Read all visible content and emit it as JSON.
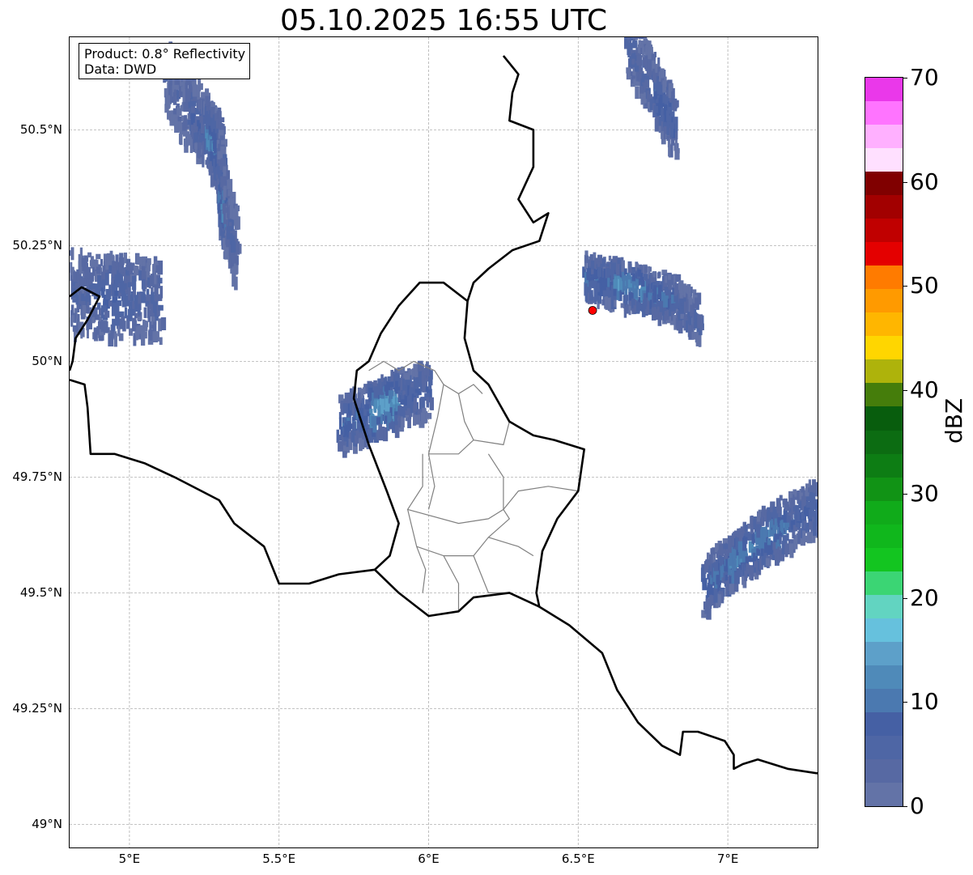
{
  "title": "05.10.2025 16:55 UTC",
  "info_box": {
    "product": "Product: 0.8° Reflectivity",
    "data": "Data: DWD"
  },
  "map": {
    "lon_range": [
      4.8,
      7.3
    ],
    "lat_range": [
      48.95,
      50.7
    ],
    "x_ticks": [
      {
        "value": 5.0,
        "label": "5°E"
      },
      {
        "value": 5.5,
        "label": "5.5°E"
      },
      {
        "value": 6.0,
        "label": "6°E"
      },
      {
        "value": 6.5,
        "label": "6.5°E"
      },
      {
        "value": 7.0,
        "label": "7°E"
      }
    ],
    "y_ticks": [
      {
        "value": 50.5,
        "label": "50.5°N"
      },
      {
        "value": 50.25,
        "label": "50.25°N"
      },
      {
        "value": 50.0,
        "label": "50°N"
      },
      {
        "value": 49.75,
        "label": "49.75°N"
      },
      {
        "value": 49.5,
        "label": "49.5°N"
      },
      {
        "value": 49.25,
        "label": "49.25°N"
      },
      {
        "value": 49.0,
        "label": "49°N"
      }
    ],
    "grid": true,
    "radar_site": {
      "lon": 6.548,
      "lat": 50.11,
      "color": "#ff0000"
    },
    "borders": [
      [
        [
          4.8,
          50.14
        ],
        [
          4.84,
          50.16
        ],
        [
          4.9,
          50.14
        ],
        [
          4.86,
          50.09
        ],
        [
          4.82,
          50.05
        ],
        [
          4.81,
          50.0
        ],
        [
          4.8,
          49.98
        ]
      ],
      [
        [
          4.8,
          49.96
        ],
        [
          4.85,
          49.95
        ],
        [
          4.86,
          49.9
        ],
        [
          4.87,
          49.8
        ],
        [
          4.95,
          49.8
        ],
        [
          5.05,
          49.78
        ],
        [
          5.15,
          49.75
        ],
        [
          5.3,
          49.7
        ],
        [
          5.35,
          49.65
        ],
        [
          5.45,
          49.6
        ],
        [
          5.5,
          49.52
        ],
        [
          5.6,
          49.52
        ],
        [
          5.7,
          49.54
        ],
        [
          5.82,
          49.55
        ],
        [
          5.9,
          49.5
        ],
        [
          6.0,
          49.45
        ],
        [
          6.1,
          49.46
        ],
        [
          6.15,
          49.49
        ],
        [
          6.27,
          49.5
        ],
        [
          6.37,
          49.47
        ]
      ],
      [
        [
          6.25,
          50.66
        ],
        [
          6.3,
          50.62
        ],
        [
          6.28,
          50.58
        ],
        [
          6.27,
          50.52
        ],
        [
          6.35,
          50.5
        ],
        [
          6.35,
          50.42
        ],
        [
          6.3,
          50.35
        ],
        [
          6.35,
          50.3
        ],
        [
          6.4,
          50.32
        ],
        [
          6.37,
          50.26
        ],
        [
          6.28,
          50.24
        ],
        [
          6.2,
          50.2
        ],
        [
          6.15,
          50.17
        ],
        [
          6.13,
          50.13
        ],
        [
          6.12,
          50.05
        ],
        [
          6.15,
          49.98
        ],
        [
          6.2,
          49.95
        ],
        [
          6.27,
          49.87
        ],
        [
          6.35,
          49.84
        ],
        [
          6.42,
          49.83
        ],
        [
          6.52,
          49.81
        ],
        [
          6.5,
          49.72
        ],
        [
          6.43,
          49.66
        ],
        [
          6.38,
          49.59
        ],
        [
          6.36,
          49.5
        ],
        [
          6.37,
          49.47
        ],
        [
          6.47,
          49.43
        ],
        [
          6.58,
          49.37
        ],
        [
          6.63,
          49.29
        ],
        [
          6.7,
          49.22
        ],
        [
          6.78,
          49.17
        ],
        [
          6.84,
          49.15
        ],
        [
          6.85,
          49.2
        ],
        [
          6.9,
          49.2
        ],
        [
          6.99,
          49.18
        ],
        [
          7.02,
          49.15
        ],
        [
          7.02,
          49.12
        ],
        [
          7.05,
          49.13
        ],
        [
          7.1,
          49.14
        ],
        [
          7.2,
          49.12
        ],
        [
          7.3,
          49.11
        ]
      ],
      [
        [
          6.13,
          50.13
        ],
        [
          6.05,
          50.17
        ],
        [
          5.97,
          50.17
        ],
        [
          5.9,
          50.12
        ],
        [
          5.84,
          50.06
        ],
        [
          5.8,
          50.0
        ],
        [
          5.76,
          49.98
        ],
        [
          5.75,
          49.92
        ],
        [
          5.8,
          49.82
        ],
        [
          5.86,
          49.72
        ],
        [
          5.9,
          49.65
        ],
        [
          5.87,
          49.58
        ],
        [
          5.82,
          49.55
        ]
      ]
    ],
    "cantons": [
      [
        [
          5.8,
          49.98
        ],
        [
          5.85,
          50.0
        ],
        [
          5.9,
          49.98
        ],
        [
          5.95,
          50.0
        ],
        [
          6.02,
          49.98
        ],
        [
          6.05,
          49.95
        ],
        [
          6.1,
          49.93
        ],
        [
          6.15,
          49.95
        ],
        [
          6.18,
          49.93
        ]
      ],
      [
        [
          6.05,
          49.95
        ],
        [
          6.03,
          49.88
        ],
        [
          6.0,
          49.8
        ],
        [
          6.1,
          49.8
        ],
        [
          6.15,
          49.83
        ],
        [
          6.25,
          49.82
        ],
        [
          6.27,
          49.87
        ]
      ],
      [
        [
          6.1,
          49.93
        ],
        [
          6.12,
          49.87
        ],
        [
          6.15,
          49.83
        ]
      ],
      [
        [
          5.98,
          49.8
        ],
        [
          5.98,
          49.73
        ],
        [
          5.93,
          49.68
        ],
        [
          6.1,
          49.65
        ],
        [
          6.2,
          49.66
        ],
        [
          6.25,
          49.68
        ],
        [
          6.3,
          49.72
        ],
        [
          6.4,
          49.73
        ],
        [
          6.5,
          49.72
        ]
      ],
      [
        [
          6.0,
          49.8
        ],
        [
          6.02,
          49.73
        ],
        [
          6.0,
          49.68
        ]
      ],
      [
        [
          6.2,
          49.8
        ],
        [
          6.25,
          49.75
        ],
        [
          6.25,
          49.68
        ]
      ],
      [
        [
          5.93,
          49.68
        ],
        [
          5.96,
          49.6
        ],
        [
          5.99,
          49.55
        ],
        [
          5.98,
          49.5
        ]
      ],
      [
        [
          5.96,
          49.6
        ],
        [
          6.05,
          49.58
        ],
        [
          6.1,
          49.52
        ],
        [
          6.1,
          49.46
        ]
      ],
      [
        [
          6.05,
          49.58
        ],
        [
          6.15,
          49.58
        ],
        [
          6.2,
          49.5
        ],
        [
          6.27,
          49.5
        ]
      ],
      [
        [
          6.15,
          49.58
        ],
        [
          6.2,
          49.62
        ],
        [
          6.3,
          49.6
        ],
        [
          6.35,
          49.58
        ]
      ],
      [
        [
          6.2,
          49.62
        ],
        [
          6.27,
          49.66
        ],
        [
          6.25,
          49.68
        ]
      ]
    ]
  },
  "colorbar": {
    "label": "dBZ",
    "min": 0,
    "max": 70,
    "ticks": [
      "0",
      "10",
      "20",
      "30",
      "40",
      "50",
      "60",
      "70"
    ],
    "colors": [
      "#6373a7",
      "#5769a3",
      "#4e66a5",
      "#4560a4",
      "#4b79b0",
      "#4f8ab9",
      "#5da0c9",
      "#66c1dd",
      "#62d4c1",
      "#3bd574",
      "#13c520",
      "#10b71c",
      "#10ab1a",
      "#119315",
      "#0d7d14",
      "#0c6c12",
      "#085d0d",
      "#457d0b",
      "#aeb30b",
      "#ffd600",
      "#ffb600",
      "#ff9a00",
      "#ff7b00",
      "#e40000",
      "#c00000",
      "#a20000",
      "#800000",
      "#ffe0ff",
      "#ffb0ff",
      "#ff74ff",
      "#ea38ea"
    ]
  },
  "echoes": [
    {
      "type": "band",
      "points": [
        [
          5.12,
          50.62
        ],
        [
          5.2,
          50.55
        ],
        [
          5.26,
          50.5
        ],
        [
          5.3,
          50.45
        ],
        [
          5.3,
          50.38
        ],
        [
          5.32,
          50.32
        ],
        [
          5.35,
          50.26
        ]
      ],
      "width": 0.08,
      "intensity": [
        4,
        7,
        12,
        7,
        12,
        5
      ]
    },
    {
      "type": "band",
      "points": [
        [
          4.8,
          50.16
        ],
        [
          4.9,
          50.15
        ],
        [
          5.0,
          50.15
        ],
        [
          5.1,
          50.14
        ]
      ],
      "width": 0.09,
      "intensity": [
        5,
        8,
        6
      ]
    },
    {
      "type": "band",
      "points": [
        [
          5.7,
          49.87
        ],
        [
          5.8,
          49.9
        ],
        [
          5.9,
          49.93
        ],
        [
          6.0,
          49.95
        ]
      ],
      "width": 0.06,
      "intensity": [
        10,
        16,
        8
      ]
    },
    {
      "type": "band",
      "points": [
        [
          6.52,
          50.19
        ],
        [
          6.62,
          50.18
        ],
        [
          6.72,
          50.16
        ],
        [
          6.82,
          50.14
        ],
        [
          6.9,
          50.1
        ]
      ],
      "width": 0.05,
      "intensity": [
        10,
        14,
        10,
        6
      ]
    },
    {
      "type": "band",
      "points": [
        [
          6.92,
          49.52
        ],
        [
          7.0,
          49.57
        ],
        [
          7.1,
          49.62
        ],
        [
          7.2,
          49.66
        ],
        [
          7.3,
          49.7
        ]
      ],
      "width": 0.06,
      "intensity": [
        10,
        13,
        12,
        8
      ]
    },
    {
      "type": "band",
      "points": [
        [
          6.66,
          50.7
        ],
        [
          6.75,
          50.6
        ],
        [
          6.82,
          50.52
        ]
      ],
      "width": 0.07,
      "intensity": [
        6,
        9
      ]
    }
  ]
}
